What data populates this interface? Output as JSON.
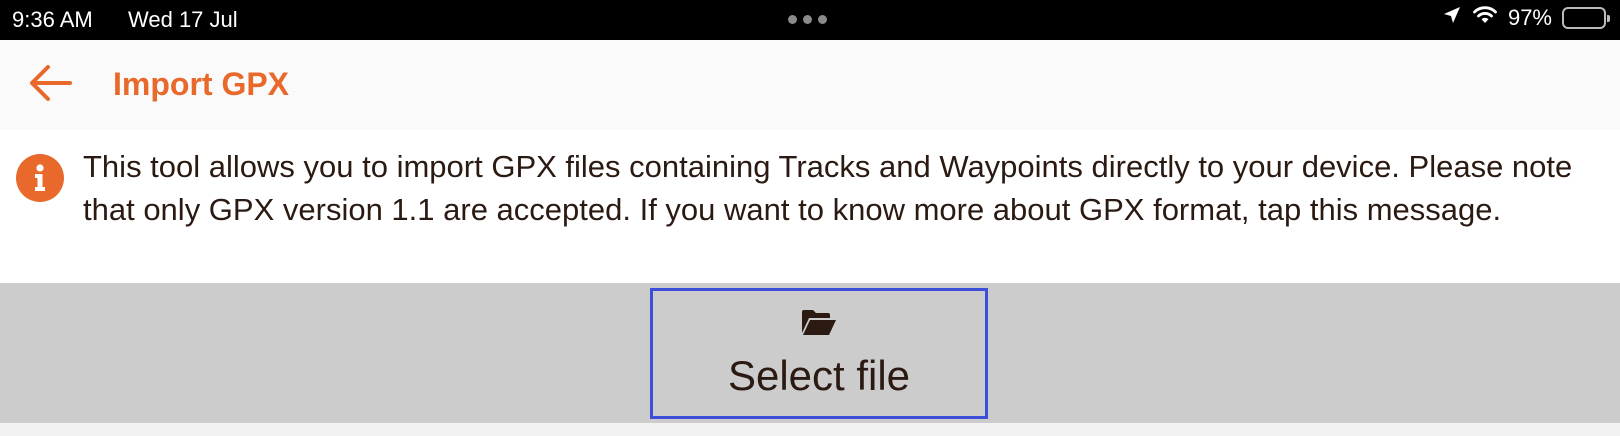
{
  "status_bar": {
    "time": "9:36 AM",
    "date": "Wed 17 Jul",
    "battery_percent": "97%",
    "battery_level": 0.97,
    "icons": [
      "location-arrow-icon",
      "wifi-icon",
      "battery-icon"
    ]
  },
  "header": {
    "back_icon": "arrow-left-icon",
    "title": "Import GPX"
  },
  "info": {
    "icon": "info-circle-icon",
    "message": "This tool allows you to import GPX files containing Tracks and Waypoints directly to your device. Please note that only GPX version 1.1 are accepted. If you want to know more about GPX format, tap this message."
  },
  "select_file": {
    "icon": "folder-open-icon",
    "label": "Select file"
  },
  "colors": {
    "accent": "#e8692b",
    "text": "#2a1a12",
    "button_band": "#cccccc",
    "focus_border": "#3d4fd8"
  }
}
